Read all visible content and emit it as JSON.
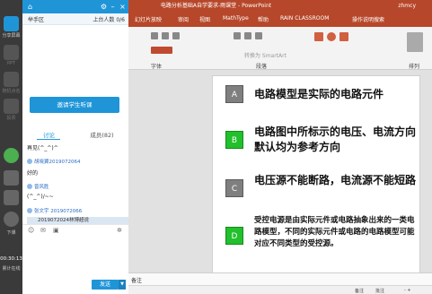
{
  "ppt": {
    "title": "电路分析基础A自学要求-雨课堂 - PowerPoint",
    "user": "zhmcy",
    "tabs": [
      "幻灯片放映",
      "审阅",
      "视图",
      "MathType",
      "帮助",
      "RAIN CLASSROOM",
      "操作说明搜索"
    ],
    "ribbon_labels": [
      "字体",
      "段落",
      "排列"
    ],
    "ribbon_text": "转换为 SmartArt",
    "notes": "备注",
    "status": [
      "备注",
      "批注"
    ],
    "zoom": "-   +"
  },
  "slide": {
    "items": [
      {
        "letter": "A",
        "color": "gray",
        "text": "电路模型是实际的电路元件"
      },
      {
        "letter": "B",
        "color": "green",
        "text": "电路图中所标示的电压、电流方向默认均为参考方向"
      },
      {
        "letter": "C",
        "color": "gray",
        "text": "电压源不能断路，电流源不能短路"
      },
      {
        "letter": "D",
        "color": "green",
        "text": "受控电源是由实际元件或电路抽象出来的一类电路模型，不同的实际元件或电路的电路模型可能对应不同类型的受控源。"
      }
    ]
  },
  "rail": {
    "items": [
      "分享屏幕",
      "PPT",
      "随机点名",
      "投票"
    ],
    "exit": "下课",
    "timer": "00:30:13",
    "info": "累计在线"
  },
  "panel": {
    "raise_hand": "举手区",
    "online": "上台人数 0/6",
    "invite_button": "邀请学生听课",
    "tab_discuss": "讨论",
    "tab_members": "成员(82)",
    "messages": [
      {
        "type": "text",
        "text": "再见(^_^)^"
      },
      {
        "type": "name",
        "text": "胡晓翼2019072064"
      },
      {
        "type": "text",
        "text": "好的"
      },
      {
        "type": "name",
        "text": "曾风胜"
      },
      {
        "type": "text",
        "text": "(^_^)/~~"
      },
      {
        "type": "name",
        "text": "张文宇 2019072066"
      }
    ],
    "highlight": "2019072024林博超说",
    "send_button": "发送",
    "send_dropdown": "▼"
  },
  "colors": {
    "ppt_red": "#b7472a",
    "panel_blue": "#1f95d8",
    "green": "#22c02c",
    "gray": "#7f7f7f"
  }
}
